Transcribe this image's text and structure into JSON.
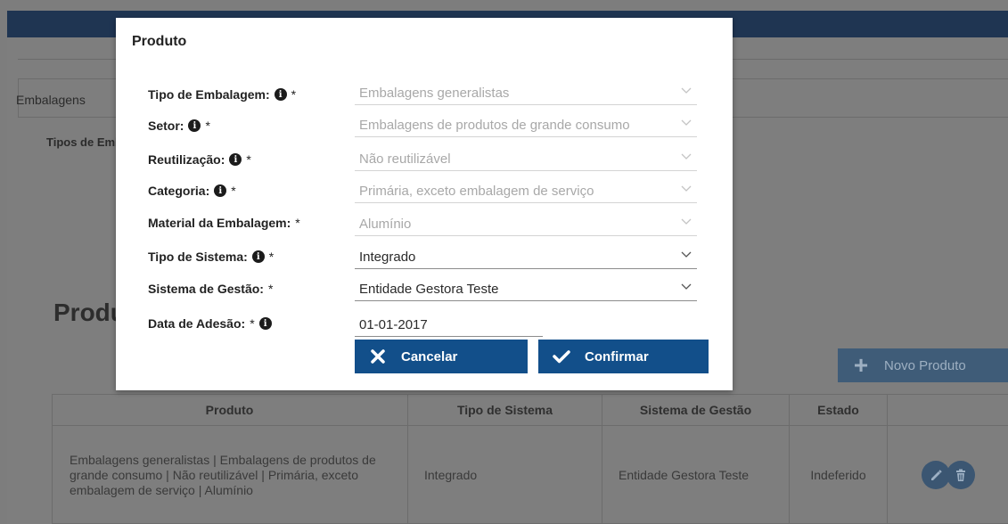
{
  "background": {
    "tab_label": "Embalagens",
    "section_label": "Tipos de Embalagem",
    "products_title": "Produtos",
    "new_product_label": "Novo Produto",
    "table": {
      "headers": [
        "Produto",
        "Tipo de Sistema",
        "Sistema de Gestão",
        "Estado"
      ],
      "row": {
        "produto": "Embalagens generalistas | Embalagens de produtos de grande consumo | Não reutilizável | Primária, exceto embalagem de serviço | Alumínio",
        "tipo_sistema": "Integrado",
        "sistema_gestao": "Entidade Gestora Teste",
        "estado": "Indeferido"
      }
    }
  },
  "modal": {
    "title": "Produto",
    "fields": [
      {
        "label": "Tipo de Embalagem:",
        "info": true,
        "required": "*",
        "value": "Embalagens generalistas"
      },
      {
        "label": "Setor:",
        "info": true,
        "required": "*",
        "value": "Embalagens de produtos de grande consumo"
      },
      {
        "label": "Reutilização:",
        "info": true,
        "required": "*",
        "value": "Não reutilizável"
      },
      {
        "label": "Categoria:",
        "info": true,
        "required": "*",
        "value": "Primária, exceto embalagem de serviço"
      },
      {
        "label": "Material da Embalagem:",
        "info": false,
        "required": "*",
        "value": "Alumínio"
      },
      {
        "label": "Tipo de Sistema:",
        "info": true,
        "required": "*",
        "value": "Integrado"
      },
      {
        "label": "Sistema de Gestão:",
        "info": false,
        "required": "*",
        "value": "Entidade Gestora Teste"
      }
    ],
    "date": {
      "label": "Data de Adesão:",
      "required": "*",
      "value": "01-01-2017"
    },
    "cancel_label": "Cancelar",
    "confirm_label": "Confirmar"
  },
  "colors": {
    "primary_button": "#124f8a",
    "overlay": "#7d7d7d",
    "header": "#1f3552"
  },
  "icons": {
    "info": "info-circle-icon",
    "chevron": "chevron-down-icon",
    "cancel": "x-icon",
    "confirm": "check-icon",
    "plus": "plus-icon",
    "edit": "pencil-icon",
    "delete": "trash-icon"
  }
}
